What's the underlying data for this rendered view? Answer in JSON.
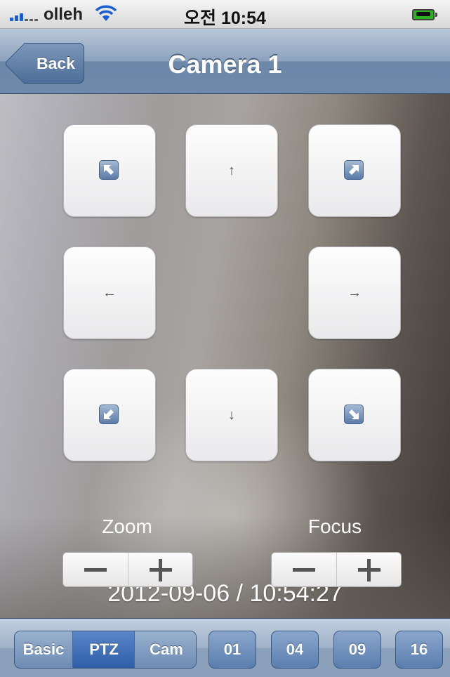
{
  "statusbar": {
    "carrier": "olleh",
    "time": "오전 10:54",
    "icons": [
      "signal-icon",
      "wifi-icon",
      "battery-charging-icon"
    ]
  },
  "navbar": {
    "back_label": "Back",
    "title": "Camera 1"
  },
  "ptz": {
    "buttons": [
      {
        "name": "up-left",
        "icon": "arrow-up-left-icon"
      },
      {
        "name": "up",
        "glyph": "↑"
      },
      {
        "name": "up-right",
        "icon": "arrow-up-right-icon"
      },
      {
        "name": "left",
        "glyph": "←"
      },
      {
        "name": "right",
        "glyph": "→"
      },
      {
        "name": "down-left",
        "icon": "arrow-down-left-icon"
      },
      {
        "name": "down",
        "glyph": "↓"
      },
      {
        "name": "down-right",
        "icon": "arrow-down-right-icon"
      }
    ],
    "zoom_label": "Zoom",
    "focus_label": "Focus"
  },
  "timestamp": "2012-09-06 / 10:54:27",
  "toolbar": {
    "modes": [
      "Basic",
      "PTZ",
      "Cam"
    ],
    "active_mode": "PTZ",
    "channels": [
      "01",
      "04",
      "09",
      "16"
    ]
  },
  "colors": {
    "nav_blue": "#6e89ab",
    "active_segment": "#2f5ea8",
    "diag_icon": "#5b7ba8"
  }
}
